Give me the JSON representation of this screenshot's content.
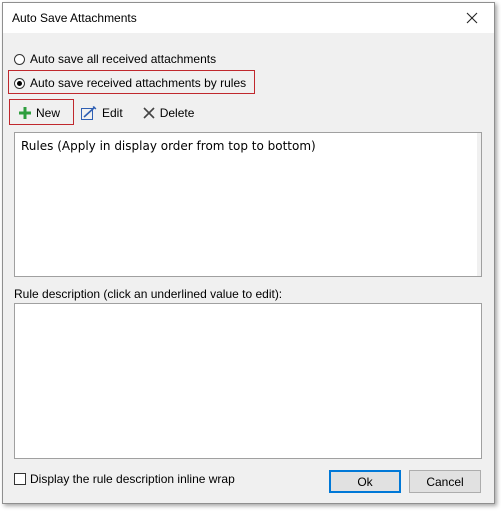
{
  "window": {
    "title": "Auto Save Attachments"
  },
  "options": {
    "save_all_label": "Auto save all received attachments",
    "save_by_rules_label": "Auto save received attachments by rules",
    "selected": "save_by_rules"
  },
  "toolbar": {
    "new_label": "New",
    "edit_label": "Edit",
    "delete_label": "Delete"
  },
  "rules": {
    "header": "Rules (Apply in display order from top to bottom)"
  },
  "description": {
    "label": "Rule description (click an underlined value to edit):"
  },
  "footer": {
    "inline_wrap_label": "Display the rule description inline wrap",
    "ok_label": "Ok",
    "cancel_label": "Cancel"
  },
  "colors": {
    "highlight": "#c0282d",
    "new_icon": "#2e9e3e",
    "edit_icon": "#2f5fb3",
    "default_button_border": "#0078d7"
  }
}
